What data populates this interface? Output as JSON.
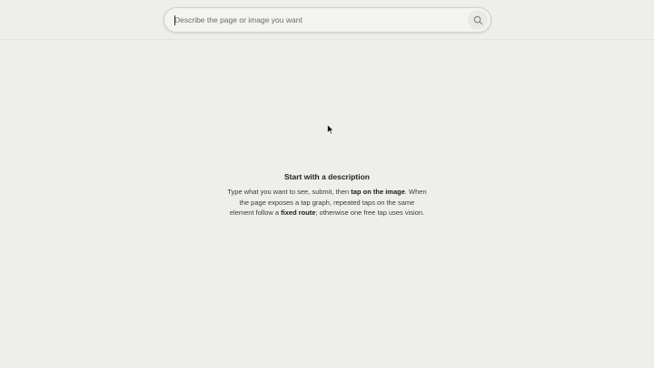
{
  "search": {
    "placeholder": "Describe the page or image you want",
    "value": "",
    "button_icon": "search-icon"
  },
  "empty_state": {
    "title": "Start with a description",
    "desc_1": "Type what you want to see, submit, then ",
    "desc_bold_1": "tap on the image",
    "desc_2": ". When the page exposes a tap graph, repeated taps on the same element follow a ",
    "desc_bold_2": "fixed route",
    "desc_3": "; otherwise one free tap uses vision."
  },
  "colors": {
    "background": "#eeeeeb",
    "search_background": "#f3f3f1",
    "search_border": "#cfcfcb"
  }
}
